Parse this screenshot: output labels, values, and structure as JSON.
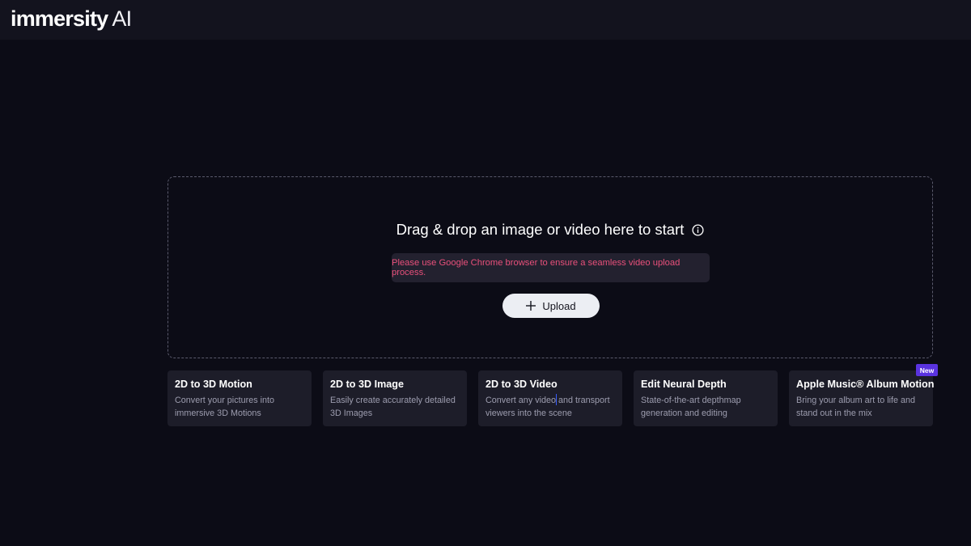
{
  "header": {
    "brand": "immersity",
    "brand_suffix": "AI"
  },
  "dropzone": {
    "title": "Drag & drop an image or video here to start",
    "info_icon": "info-icon",
    "warning": "Please use Google Chrome browser to ensure a seamless video upload process.",
    "upload_label": "Upload",
    "warning_color": "#e9507b"
  },
  "cards": [
    {
      "title": "2D to 3D Motion",
      "description": "Convert your pictures into immersive 3D Motions"
    },
    {
      "title": "2D to 3D Image",
      "description": "Easily create accurately detailed 3D Images"
    },
    {
      "title": "2D to 3D Video",
      "description": "Convert any video and transport viewers into the scene"
    },
    {
      "title": "Edit Neural Depth",
      "description": "State-of-the-art depthmap generation and editing"
    },
    {
      "title": "Apple Music® Album Motion",
      "description": "Bring your album art to life and stand out in the mix",
      "badge": "New"
    }
  ],
  "colors": {
    "background": "#0c0c16",
    "header": "#13131e",
    "card": "#1d1d29",
    "badge": "#5a33e0"
  }
}
